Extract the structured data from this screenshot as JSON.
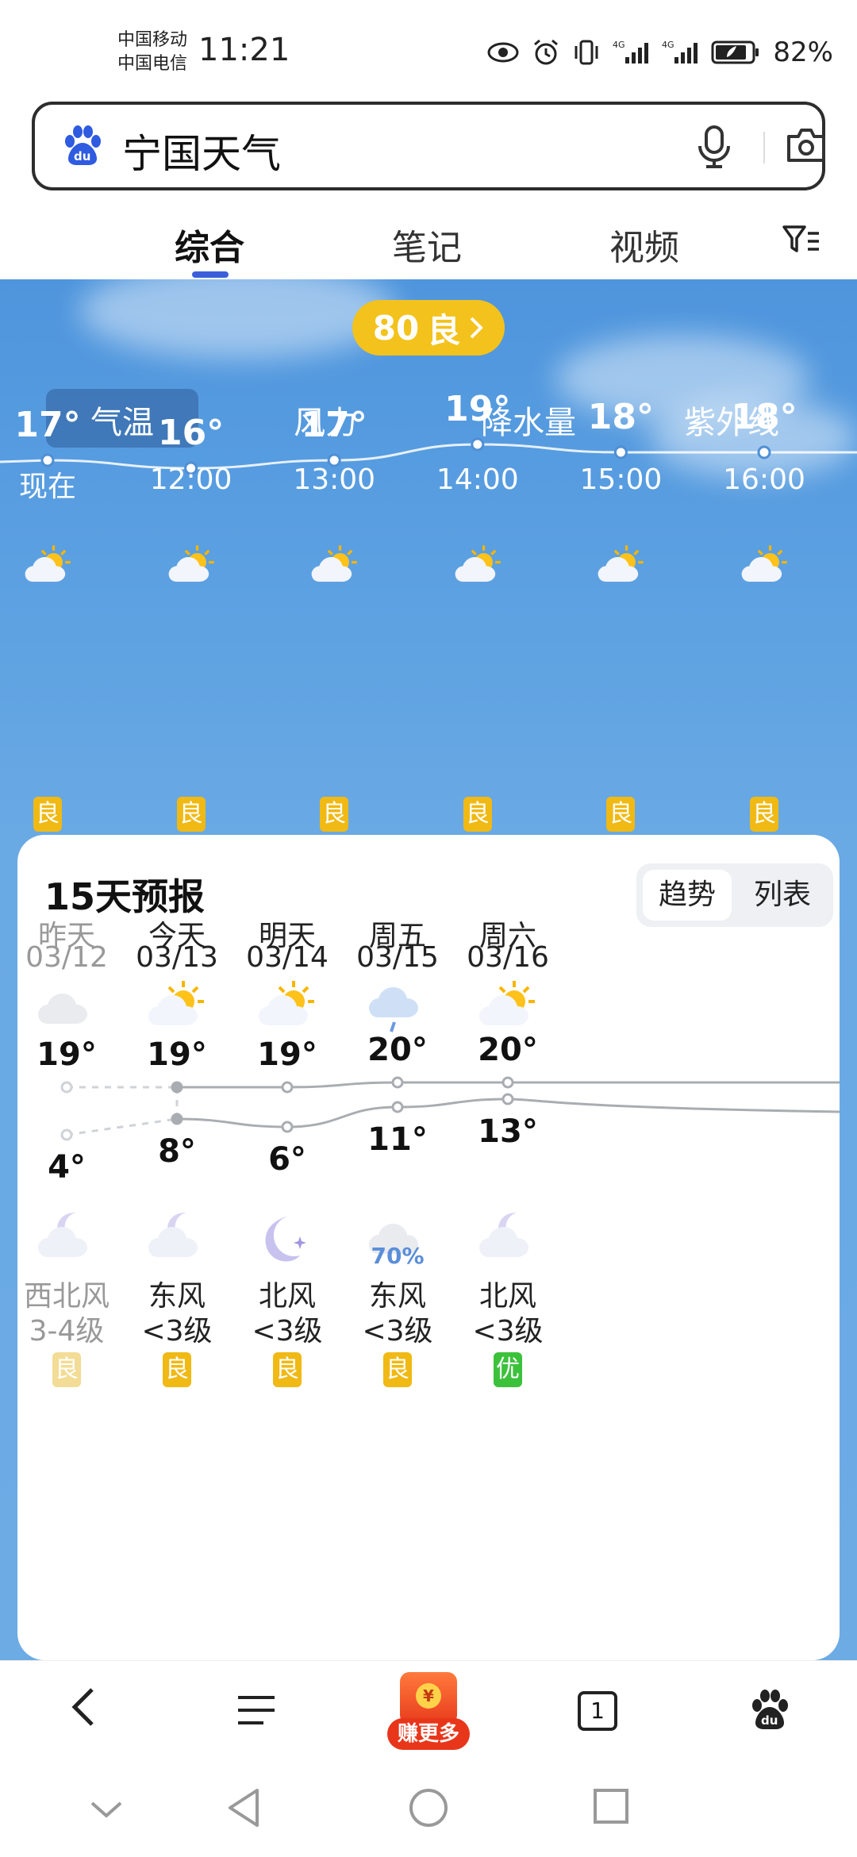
{
  "status_bar": {
    "carrier1": "中国移动",
    "carrier2": "中国电信",
    "time": "11:21",
    "battery": "82%"
  },
  "search": {
    "query": "宁国天气"
  },
  "tabs": [
    {
      "label": "综合",
      "active": true
    },
    {
      "label": "笔记",
      "active": false
    },
    {
      "label": "视频",
      "active": false
    }
  ],
  "weather": {
    "aqi": {
      "value": "80",
      "level": "良"
    },
    "metric_tabs": [
      "气温",
      "风力",
      "降水量",
      "紫外线"
    ],
    "active_metric": "气温",
    "hourly": [
      {
        "time": "现在",
        "temp": "17°",
        "t": 17,
        "aqi": "良",
        "icon": "sun-cloud-icon"
      },
      {
        "time": "12:00",
        "temp": "16°",
        "t": 16,
        "aqi": "良",
        "icon": "sun-cloud-icon"
      },
      {
        "time": "13:00",
        "temp": "17°",
        "t": 17,
        "aqi": "良",
        "icon": "sun-cloud-icon"
      },
      {
        "time": "14:00",
        "temp": "19°",
        "t": 19,
        "aqi": "良",
        "icon": "sun-cloud-icon"
      },
      {
        "time": "15:00",
        "temp": "18°",
        "t": 18,
        "aqi": "良",
        "icon": "sun-cloud-icon"
      },
      {
        "time": "16:00",
        "temp": "18°",
        "t": 18,
        "aqi": "良",
        "icon": "sun-cloud-icon"
      }
    ]
  },
  "forecast": {
    "title": "15天预报",
    "view_options": [
      "趋势",
      "列表"
    ],
    "active_view": "趋势",
    "days": [
      {
        "name": "昨天",
        "date": "03/12",
        "high": "19°",
        "low": "4°",
        "h": 19,
        "l": 4,
        "day_icon": "cloud-icon",
        "night_icon": "moon-cloud-icon",
        "wind_dir": "西北风",
        "wind_level": "3-4级",
        "aqi": "良",
        "aqi_color": "#f3dc95",
        "past": true,
        "rain": ""
      },
      {
        "name": "今天",
        "date": "03/13",
        "high": "19°",
        "low": "8°",
        "h": 19,
        "l": 8,
        "day_icon": "sun-cloud-icon",
        "night_icon": "moon-cloud-icon",
        "wind_dir": "东风",
        "wind_level": "<3级",
        "aqi": "良",
        "aqi_color": "#f0b914",
        "past": false,
        "rain": ""
      },
      {
        "name": "明天",
        "date": "03/14",
        "high": "19°",
        "low": "6°",
        "h": 19,
        "l": 6,
        "day_icon": "sun-cloud-icon",
        "night_icon": "moon-stars-icon",
        "wind_dir": "北风",
        "wind_level": "<3级",
        "aqi": "良",
        "aqi_color": "#f0b914",
        "past": false,
        "rain": ""
      },
      {
        "name": "周五",
        "date": "03/15",
        "high": "20°",
        "low": "11°",
        "h": 20,
        "l": 11,
        "day_icon": "rain-cloud-icon",
        "night_icon": "cloud-icon",
        "wind_dir": "东风",
        "wind_level": "<3级",
        "aqi": "良",
        "aqi_color": "#f0b914",
        "past": false,
        "rain": "70%"
      },
      {
        "name": "周六",
        "date": "03/16",
        "high": "20°",
        "low": "13°",
        "h": 20,
        "l": 13,
        "day_icon": "sun-cloud-icon",
        "night_icon": "moon-cloud-icon",
        "wind_dir": "北风",
        "wind_level": "<3级",
        "aqi": "优",
        "aqi_color": "#3cc13b",
        "past": false,
        "rain": ""
      }
    ]
  },
  "bottom_nav": {
    "earn_label": "赚更多",
    "tab_count": "1"
  }
}
